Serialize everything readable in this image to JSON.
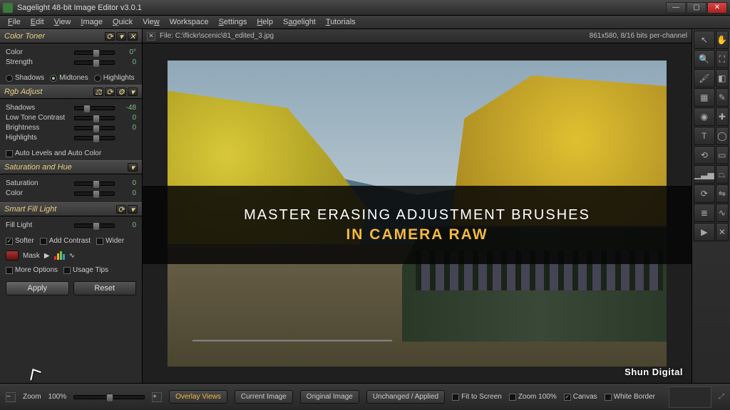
{
  "window": {
    "title": "Sagelight 48-bit Image Editor v3.0.1"
  },
  "menu": [
    "File",
    "Edit",
    "View",
    "Image",
    "Quick",
    "View",
    "Workspace",
    "Settings",
    "Help",
    "Sagelight",
    "Tutorials"
  ],
  "file": {
    "prefix": "File:",
    "path": "C:\\flickr\\scenic\\81_edited_3.jpg",
    "dims": "861x580, 8/16 bits per-channel"
  },
  "panels": {
    "colorToner": {
      "title": "Color Toner",
      "color": {
        "label": "Color",
        "value": "0°"
      },
      "strength": {
        "label": "Strength",
        "value": "0"
      },
      "modes": {
        "shadows": "Shadows",
        "midtones": "Midtones",
        "highlights": "Highlights",
        "selected": "midtones"
      }
    },
    "rgbAdjust": {
      "title": "Rgb Adjust",
      "shadows": {
        "label": "Shadows",
        "value": "-48"
      },
      "lowTone": {
        "label": "Low Tone Contrast",
        "value": "0"
      },
      "brightness": {
        "label": "Brightness",
        "value": "0"
      },
      "highlights": {
        "label": "Highlights",
        "value": ""
      },
      "auto": {
        "levels": "Auto Levels and Auto Color"
      }
    },
    "satHue": {
      "title": "Saturation and Hue",
      "saturation": {
        "label": "Saturation",
        "value": "0"
      },
      "color": {
        "label": "Color",
        "value": "0"
      }
    },
    "smartFill": {
      "title": "Smart Fill Light",
      "fillLight": {
        "label": "Fill Light",
        "value": "0"
      },
      "opts": {
        "softer": "Softer",
        "addContrast": "Add Contrast",
        "wider": "Wider"
      }
    },
    "mask": {
      "label": "Mask"
    },
    "moreOptions": "More Options",
    "usageTips": "Usage Tips",
    "apply": "Apply",
    "reset": "Reset"
  },
  "overlay": {
    "line1": "MASTER ERASING ADJUSTMENT BRUSHES",
    "line2": "IN CAMERA RAW"
  },
  "watermark": "Shun Digital",
  "bottom": {
    "zoom": {
      "label": "Zoom",
      "value": "100%"
    },
    "views": {
      "label": "Overlay Views",
      "current": "Current Image",
      "original": "Original Image",
      "split": "Unchanged / Applied"
    },
    "fit": "Fit to Screen",
    "z100": "Zoom 100%",
    "canvas": "Canvas",
    "white": "White Border"
  }
}
